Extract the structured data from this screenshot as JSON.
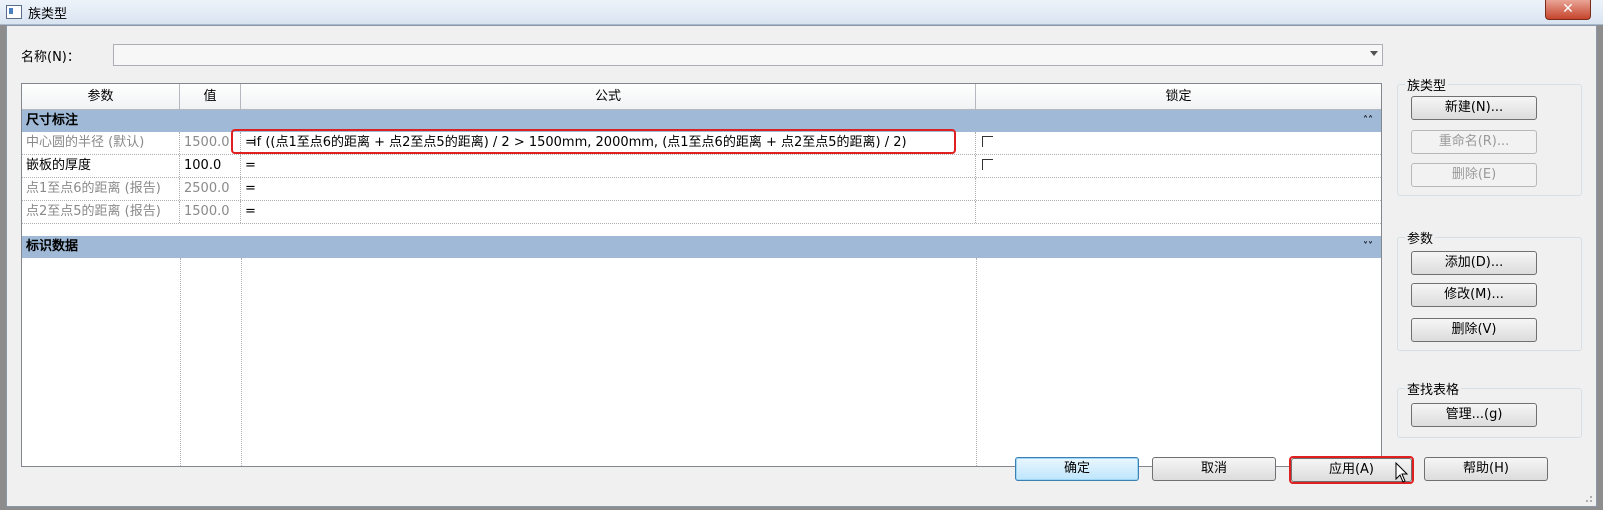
{
  "window": {
    "title": "族类型",
    "close_glyph": "✕"
  },
  "name_row": {
    "label": "名称(N)：",
    "value": ""
  },
  "table": {
    "headers": {
      "param": "参数",
      "value": "值",
      "formula": "公式",
      "lock": "锁定"
    },
    "groups": [
      {
        "label": "尺寸标注",
        "chevron": "˄˄",
        "rows": [
          {
            "param": "中心圆的半径 (默认)",
            "value": "1500.0",
            "formula_eq": "=",
            "formula": "if ((点1至点6的距离 + 点2至点5的距离) / 2 > 1500mm, 2000mm, (点1至点6的距离 + 点2至点5的距离) / 2)",
            "lock": true
          },
          {
            "param": "嵌板的厚度",
            "value": "100.0",
            "formula_eq": "=",
            "formula": "",
            "lock": true
          },
          {
            "param": "点1至点6的距离 (报告)",
            "value": "2500.0",
            "formula_eq": "=",
            "formula": "",
            "lock": false
          },
          {
            "param": "点2至点5的距离 (报告)",
            "value": "1500.0",
            "formula_eq": "=",
            "formula": "",
            "lock": false
          }
        ]
      },
      {
        "label": "标识数据",
        "chevron": "˅˅",
        "rows": []
      }
    ]
  },
  "family_types": {
    "title": "族类型",
    "new_label": "新建(N)...",
    "rename_label": "重命名(R)...",
    "delete_label": "删除(E)"
  },
  "parameters": {
    "title": "参数",
    "add_label": "添加(D)...",
    "modify_label": "修改(M)...",
    "delete_label": "删除(V)"
  },
  "lookup": {
    "title": "查找表格",
    "manage_label": "管理...(g)"
  },
  "footer": {
    "ok_label": "确定",
    "cancel_label": "取消",
    "apply_label": "应用(A)",
    "help_label": "帮助(H)"
  },
  "colors": {
    "group_header": "#9fb9d6",
    "highlight": "#e02020",
    "readonly_text": "#8a8a8a"
  }
}
